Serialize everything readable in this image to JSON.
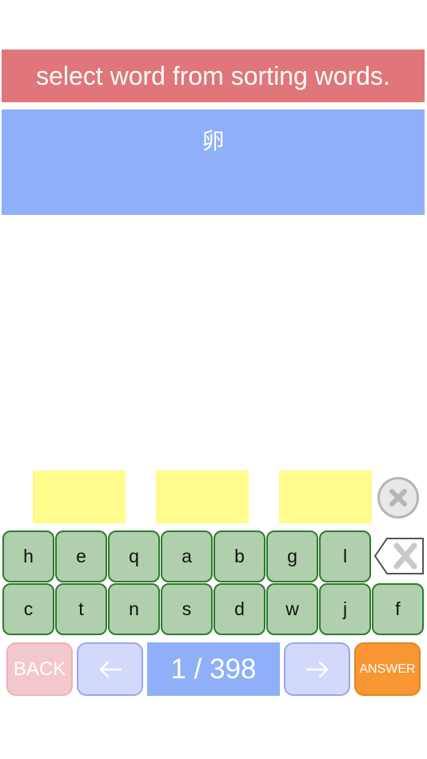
{
  "instruction": "select word from sorting words.",
  "question": "卵",
  "answer_slots": [
    "",
    "",
    ""
  ],
  "keyboard": {
    "row1": [
      "h",
      "e",
      "q",
      "a",
      "b",
      "g",
      "l"
    ],
    "row2": [
      "c",
      "t",
      "n",
      "s",
      "d",
      "w",
      "j",
      "f"
    ]
  },
  "icons": {
    "clear": "clear-circle-x-icon",
    "backspace": "backspace-icon",
    "prev": "arrow-left-icon",
    "next": "arrow-right-icon"
  },
  "nav": {
    "back_label": "BACK",
    "counter": "1 / 398",
    "answer_label": "ANSWER"
  },
  "colors": {
    "instruction_bg": "#e07679",
    "question_bg": "#8fb0f8",
    "slot_bg": "#fffb8c",
    "key_bg": "#afcfad",
    "answer_bg": "#f79633"
  }
}
